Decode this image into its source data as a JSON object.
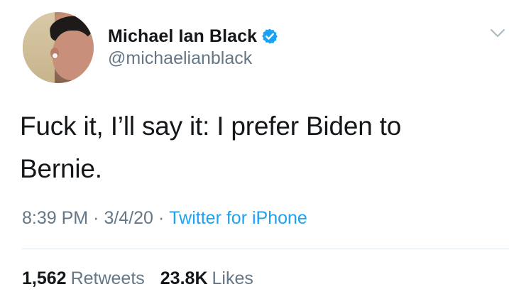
{
  "user": {
    "display_name": "Michael Ian Black",
    "handle": "@michaelianblack",
    "verified": true,
    "verified_color": "#1da1f2"
  },
  "tweet": {
    "line1": "Fuck it, I’ll say it: I prefer Biden to",
    "line2": "Bernie."
  },
  "meta": {
    "time": "8:39 PM",
    "sep1": "·",
    "date": "3/4/20",
    "sep2": "·",
    "source": "Twitter for iPhone"
  },
  "stats": {
    "retweets_count": "1,562",
    "retweets_label": "Retweets",
    "likes_count": "23.8K",
    "likes_label": "Likes"
  },
  "icons": {
    "verified": "verified-badge-icon",
    "menu": "chevron-down-icon"
  }
}
